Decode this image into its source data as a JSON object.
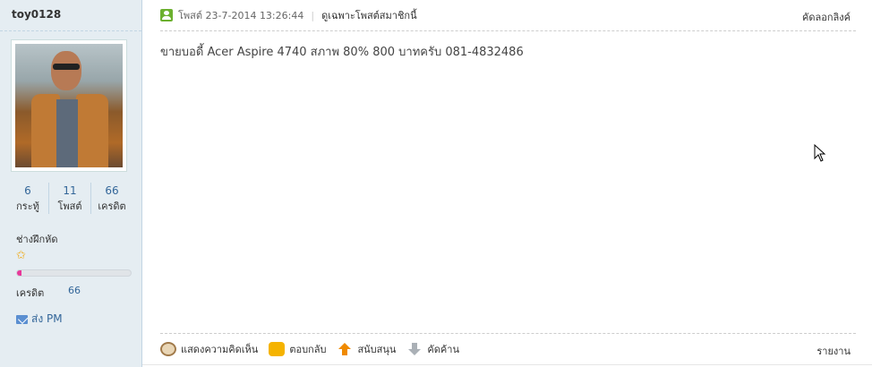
{
  "sidebar": {
    "username": "toy0128",
    "stats": [
      {
        "value": "6",
        "label": "กระทู้"
      },
      {
        "value": "11",
        "label": "โพสต์"
      },
      {
        "value": "66",
        "label": "เครดิต"
      }
    ],
    "rank_title": "ช่างฝึกหัด",
    "rank_progress": 0.04,
    "credit_label": "เครดิต",
    "credit_value": "66",
    "pm_label": "ส่ง PM"
  },
  "post": {
    "posted_text": "โพสต์ 23-7-2014 13:26:44",
    "only_author": "ดูเฉพาะโพสต์สมาชิกนี้",
    "copy_link": "คัดลอกลิงค์",
    "body": "ขายบอดี้ Acer Aspire 4740 สภาพ 80% 800 บาทครับ 081-4832486"
  },
  "actions": {
    "comment": "แสดงความคิดเห็น",
    "reply": "ตอบกลับ",
    "support": "สนับสนุน",
    "oppose": "คัดค้าน",
    "report": "รายงาน"
  },
  "colors": {
    "sidebar_bg": "#e5edf2",
    "link": "#336699",
    "rank_fill": "#e8389a"
  }
}
